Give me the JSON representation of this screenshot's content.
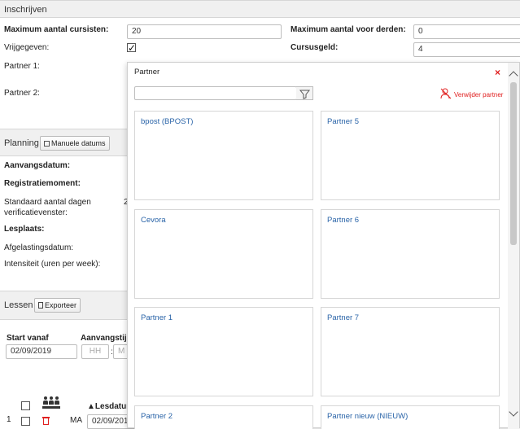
{
  "inschrijven": {
    "title": "Inschrijven",
    "max_cursisten_label": "Maximum aantal cursisten:",
    "max_cursisten_value": "20",
    "max_derden_label": "Maximum aantal voor derden:",
    "max_derden_value": "0",
    "vrijgegeven_label": "Vrijgegeven:",
    "vrijgegeven_checked": true,
    "cursusgeld_label": "Cursusgeld:",
    "cursusgeld_value": "4",
    "partner1_label": "Partner 1:",
    "partner2_label": "Partner 2:"
  },
  "planning": {
    "title": "Planning",
    "manuele_datums_label": "Manuele datums",
    "aanvangsdatum_label": "Aanvangsdatum:",
    "registratiemoment_label": "Registratiemoment:",
    "verificatie_label_line1": "Standaard aantal dagen",
    "verificatie_label_line2": "verificatievenster:",
    "verificatie_value": "2",
    "lesplaats_label": "Lesplaats:",
    "afgelastingsdatum_label": "Afgelastingsdatum:",
    "intensiteit_label": "Intensiteit (uren per week):"
  },
  "lessen": {
    "title": "Lessen",
    "exporteer_label": "Exporteer",
    "start_vanaf_label": "Start vanaf",
    "start_vanaf_value": "02/09/2019",
    "aanvangstijd_label": "Aanvangstijd",
    "hour_placeholder": "HH",
    "minute_placeholder": "M",
    "lesdatum_header": "▲Lesdatum",
    "rows": [
      {
        "nr": "1",
        "day": "MA",
        "date": "02/09/2019"
      }
    ]
  },
  "partner_popup": {
    "title": "Partner",
    "search_placeholder": "",
    "remove_label": "Verwijder partner",
    "partners": [
      {
        "name": "bpost (BPOST)"
      },
      {
        "name": "Partner 5"
      },
      {
        "name": "Cevora"
      },
      {
        "name": "Partner 6"
      },
      {
        "name": "Partner 1"
      },
      {
        "name": "Partner 7"
      },
      {
        "name": "Partner 2"
      },
      {
        "name": "Partner nieuw (NIEUW)"
      }
    ]
  },
  "colors": {
    "link": "#2a64a8",
    "danger": "#e02020",
    "section_bg": "#f0f0f0"
  },
  "icons": {
    "close": "close-icon",
    "filter": "filter-icon",
    "remove_user": "remove-user-icon",
    "calendar": "calendar-icon",
    "export": "export-icon",
    "trash": "trash-icon",
    "group": "group-icon"
  }
}
